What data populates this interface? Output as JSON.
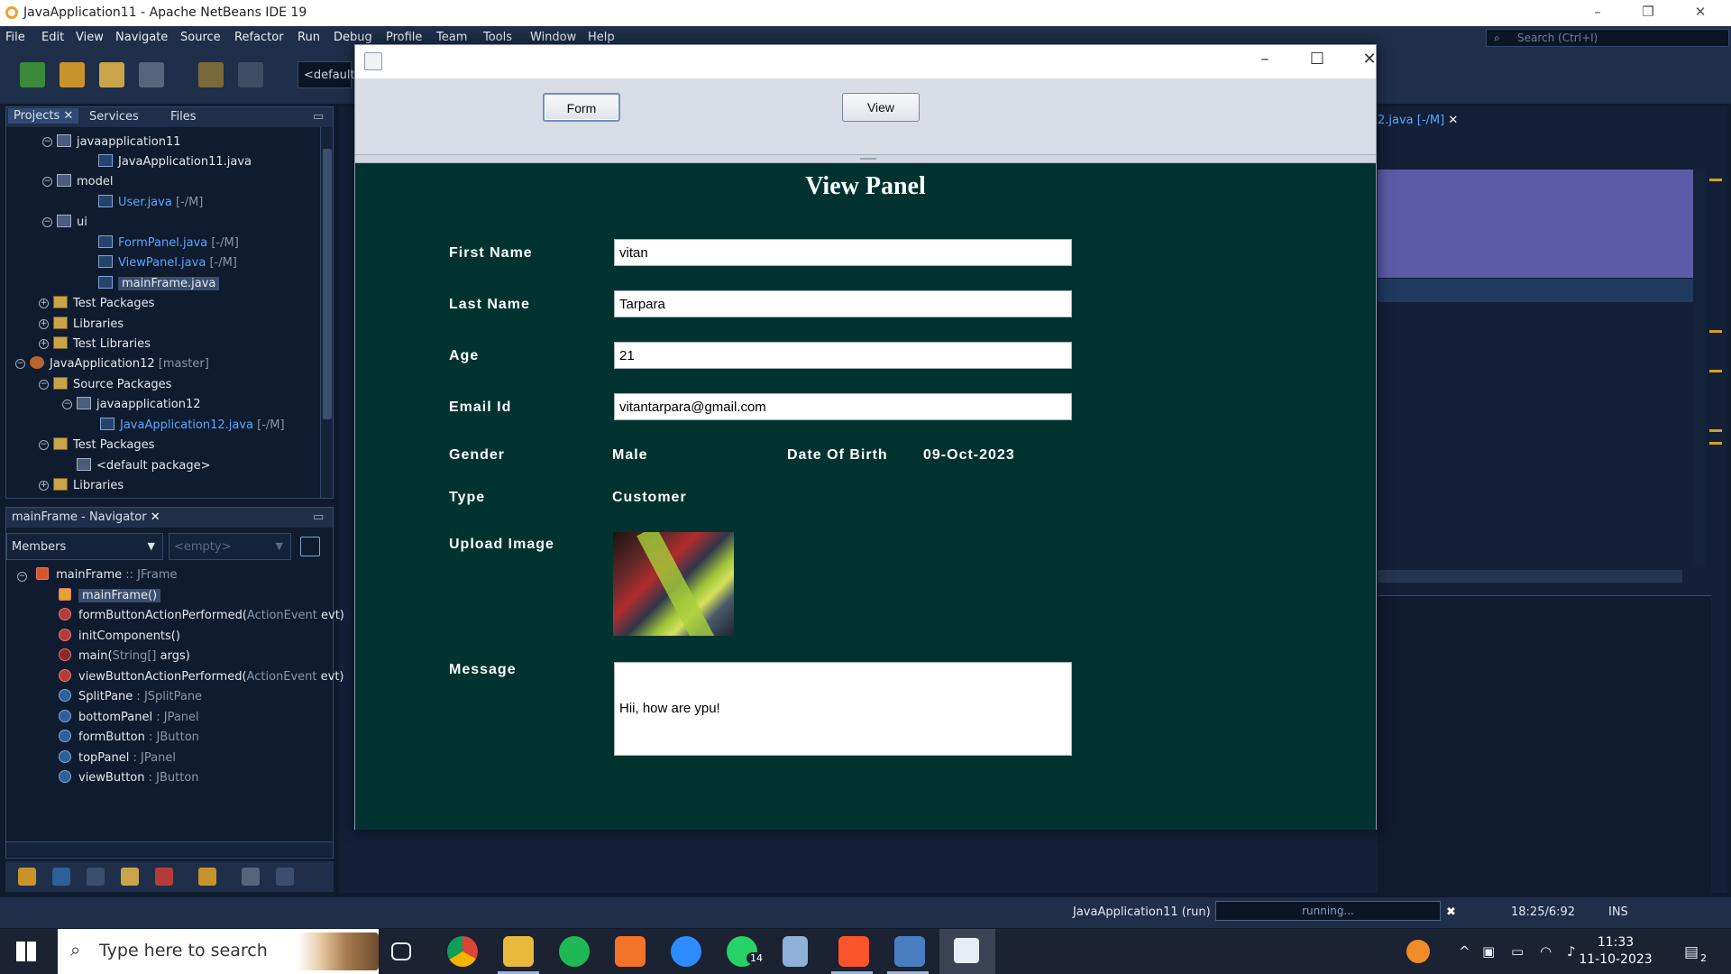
{
  "ide": {
    "window_title": "JavaApplication11 - Apache NetBeans IDE 19",
    "menu": [
      "File",
      "Edit",
      "View",
      "Navigate",
      "Source",
      "Refactor",
      "Run",
      "Debug",
      "Profile",
      "Team",
      "Tools",
      "Window",
      "Help"
    ],
    "search_placeholder": "Search (Ctrl+I)",
    "config_combo": "<default",
    "project_tabs": [
      "Projects",
      "Services",
      "Files"
    ],
    "editor_tab": "2.java [-/M]",
    "project_tree": [
      {
        "text": "javaapplication11",
        "suffix": ""
      },
      {
        "text": "JavaApplication11.java",
        "suffix": ""
      },
      {
        "text": "model",
        "suffix": ""
      },
      {
        "text": "User.java",
        "suffix": "[-/M]"
      },
      {
        "text": "ui",
        "suffix": ""
      },
      {
        "text": "FormPanel.java",
        "suffix": "[-/M]"
      },
      {
        "text": "ViewPanel.java",
        "suffix": "[-/M]"
      },
      {
        "text": "mainFrame.java",
        "suffix": ""
      },
      {
        "text": "Test Packages",
        "suffix": ""
      },
      {
        "text": "Libraries",
        "suffix": ""
      },
      {
        "text": "Test Libraries",
        "suffix": ""
      },
      {
        "text": "JavaApplication12",
        "suffix": "[master]"
      },
      {
        "text": "Source Packages",
        "suffix": ""
      },
      {
        "text": "javaapplication12",
        "suffix": ""
      },
      {
        "text": "JavaApplication12.java",
        "suffix": "[-/M]"
      },
      {
        "text": "Test Packages",
        "suffix": ""
      },
      {
        "text": "<default package>",
        "suffix": ""
      },
      {
        "text": "Libraries",
        "suffix": ""
      }
    ],
    "navigator": {
      "title": "mainFrame - Navigator",
      "members_combo": "Members",
      "filter_combo": "<empty>",
      "root_name": "mainFrame",
      "root_type": ":: JFrame",
      "members": [
        {
          "name": "mainFrame()",
          "type": ""
        },
        {
          "name": "formButtonActionPerformed(",
          "type": "ActionEvent",
          "tail": " evt)"
        },
        {
          "name": "initComponents()",
          "type": ""
        },
        {
          "name": "main(",
          "type": "String[]",
          "tail": " args)"
        },
        {
          "name": "viewButtonActionPerformed(",
          "type": "ActionEvent",
          "tail": " evt)"
        },
        {
          "name": "SplitPane",
          "type": " : JSplitPane"
        },
        {
          "name": "bottomPanel",
          "type": " : JPanel"
        },
        {
          "name": "formButton",
          "type": " : JButton"
        },
        {
          "name": "topPanel",
          "type": " : JPanel"
        },
        {
          "name": "viewButton",
          "type": " : JButton"
        }
      ]
    },
    "status": {
      "run_label": "JavaApplication11 (run)",
      "progress_text": "running...",
      "position": "18:25/6:92",
      "mode": "INS"
    }
  },
  "app": {
    "buttons": {
      "form": "Form",
      "view": "View"
    },
    "panel_title": "View Panel",
    "labels": {
      "first_name": "First Name",
      "last_name": "Last Name",
      "age": "Age",
      "email": "Email Id",
      "gender": "Gender",
      "dob": "Date Of Birth",
      "type": "Type",
      "upload": "Upload Image",
      "message": "Message"
    },
    "values": {
      "first_name": "vitan",
      "last_name": "Tarpara",
      "age": "21",
      "email": "vitantarpara@gmail.com",
      "gender": "Male",
      "dob": "09-Oct-2023",
      "type": "Customer",
      "message": "Hii, how are ypu!"
    }
  },
  "taskbar": {
    "search_placeholder": "Type here to search",
    "whatsapp_badge": "14",
    "time": "11:33",
    "date": "11-10-2023",
    "notif_count": "2"
  },
  "colors": {
    "app_bottom_panel": "#003330",
    "ide_bg": "#0f1b2e",
    "link_blue": "#5aa8ff"
  }
}
